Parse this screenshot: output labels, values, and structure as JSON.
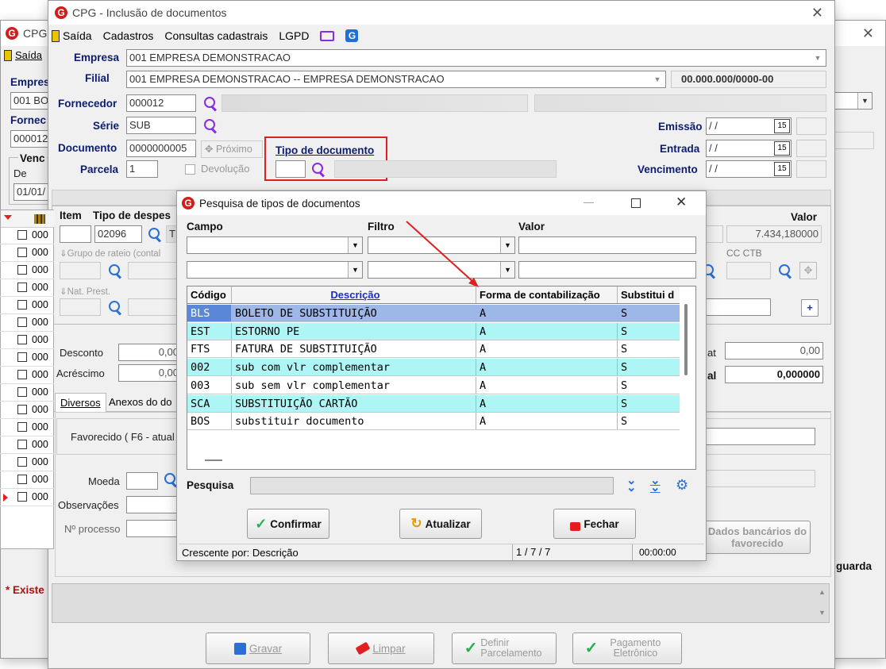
{
  "bg_window": {
    "title": "CPG",
    "menu_saida": "Saída",
    "empresa_label": "Empres",
    "empresa_value": "001 BO",
    "fornec_label": "Fornec",
    "fornec_value": "000012",
    "venc_label": "Venc",
    "de_label": "De",
    "de_value": "01/01/",
    "existe_label": "* Existe",
    "guarda_label": "guarda"
  },
  "main_window": {
    "title": "CPG - Inclusão de documentos",
    "menu": [
      "Saída",
      "Cadastros",
      "Consultas cadastrais",
      "LGPD"
    ],
    "labels": {
      "empresa": "Empresa",
      "filial": "Filial",
      "fornecedor": "Fornecedor",
      "serie": "Série",
      "documento": "Documento",
      "parcela": "Parcela",
      "tipo_documento": "Tipo de documento",
      "emissao": "Emissão",
      "entrada": "Entrada",
      "vencimento": "Vencimento",
      "proximo": "Próximo",
      "devolucao": "Devolução",
      "item": "Item",
      "tipo_despesa": "Tipo de despes",
      "valor": "Valor",
      "grupo_rateio": "Grupo de rateio (contal",
      "cc_ctb": "CC CTB",
      "nat_prest": "Nat. Prest.",
      "desconto": "Desconto",
      "acrescimo": "Acréscimo",
      "tab_diversos": "Diversos",
      "tab_anexos": "Anexos do do",
      "favorecido": "Favorecido ( F6 - atual",
      "moeda": "Moeda",
      "observacoes": "Observações",
      "nr_processo": "Nº processo",
      "tot_label1": "at",
      "tot_label2": "al",
      "dados_bancarios": "Dados bancários do favorecido"
    },
    "values": {
      "empresa": "001 EMPRESA DEMONSTRACAO",
      "filial": "001 EMPRESA DEMONSTRACAO -- EMPRESA DEMONSTRACAO",
      "cnpj": "00.000.000/0000-00",
      "fornecedor": "000012",
      "serie": "SUB",
      "documento": "0000000005",
      "parcela": "1",
      "emissao": "/ /",
      "entrada": "/ /",
      "vencimento": "/ /",
      "tipo_despesa": "02096",
      "tipo_despesa_desc": "T",
      "valor": "7.434,180000",
      "desconto": "0,00",
      "acrescimo": "0,00",
      "total1": "0,00",
      "total2": "0,000000"
    },
    "grid_rows_prefix": [
      "000",
      "000",
      "000",
      "000",
      "000",
      "000",
      "000",
      "000",
      "000",
      "000",
      "000",
      "000",
      "000",
      "000",
      "000",
      "000"
    ],
    "footer_buttons": {
      "gravar": "Gravar",
      "limpar": "Limpar",
      "definir": "Definir Parcelamento",
      "pagamento": "Pagamento Eletrônico"
    }
  },
  "dialog": {
    "title": "Pesquisa de tipos de documentos",
    "campo_label": "Campo",
    "filtro_label": "Filtro",
    "valor_label": "Valor",
    "columns": [
      "Código",
      "Descrição",
      "Forma de contabilização",
      "Substitui d"
    ],
    "rows": [
      {
        "codigo": "BLS",
        "descricao": "BOLETO DE SUBSTITUIÇÃO",
        "forma": "A",
        "subst": "S"
      },
      {
        "codigo": "EST",
        "descricao": "ESTORNO PE",
        "forma": "A",
        "subst": "S"
      },
      {
        "codigo": "FTS",
        "descricao": "FATURA DE SUBSTITUIÇÃO",
        "forma": "A",
        "subst": "S"
      },
      {
        "codigo": "002",
        "descricao": "sub com vlr complementar",
        "forma": "A",
        "subst": "S"
      },
      {
        "codigo": "003",
        "descricao": "sub sem vlr complementar",
        "forma": "A",
        "subst": "S"
      },
      {
        "codigo": "SCA",
        "descricao": "SUBSTITUIÇÃO CARTÃO",
        "forma": "A",
        "subst": "S"
      },
      {
        "codigo": "BOS",
        "descricao": "substituir documento",
        "forma": "A",
        "subst": "S"
      }
    ],
    "pesquisa_label": "Pesquisa",
    "buttons": {
      "confirmar": "Confirmar",
      "atualizar": "Atualizar",
      "fechar": "Fechar"
    },
    "status": {
      "order": "Crescente por: Descrição",
      "count": "1 / 7 / 7",
      "time": "00:00:00"
    }
  },
  "colors": {
    "highlight_red": "#e02020",
    "selected_row": "#9db7e6",
    "alt_row": "#aef5f5",
    "label_blue": "#0d1d6d"
  }
}
